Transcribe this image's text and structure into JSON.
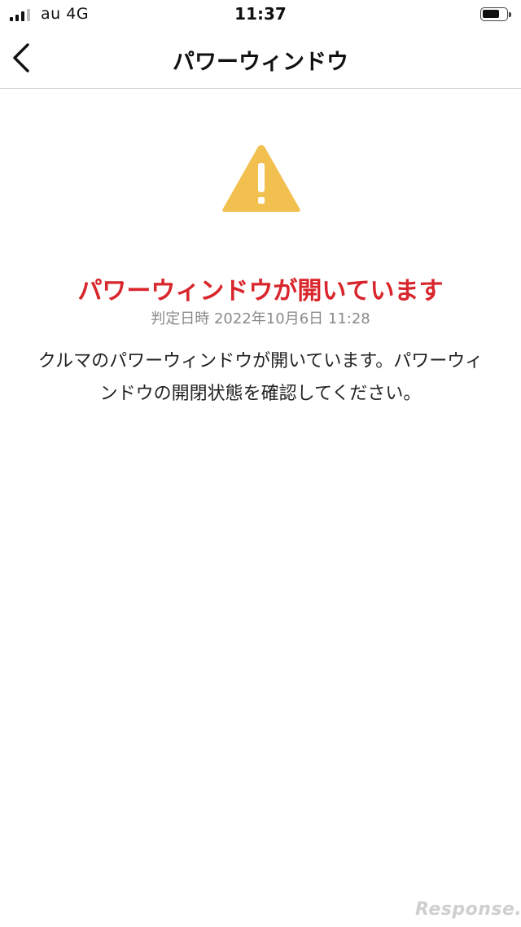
{
  "status_bar": {
    "carrier": "au  4G",
    "time": "11:37"
  },
  "nav": {
    "title": "パワーウィンドウ"
  },
  "alert": {
    "title": "パワーウィンドウが開いています",
    "judged_label": "判定日時",
    "judged_datetime": "2022年10月6日 11:28",
    "description": "クルマのパワーウィンドウが開いています。パワーウィンドウの開閉状態を確認してください。",
    "icon": "warning-triangle-icon",
    "icon_color": "#f2c04e",
    "title_color": "#d8262c"
  },
  "watermark": {
    "text": "Response."
  }
}
